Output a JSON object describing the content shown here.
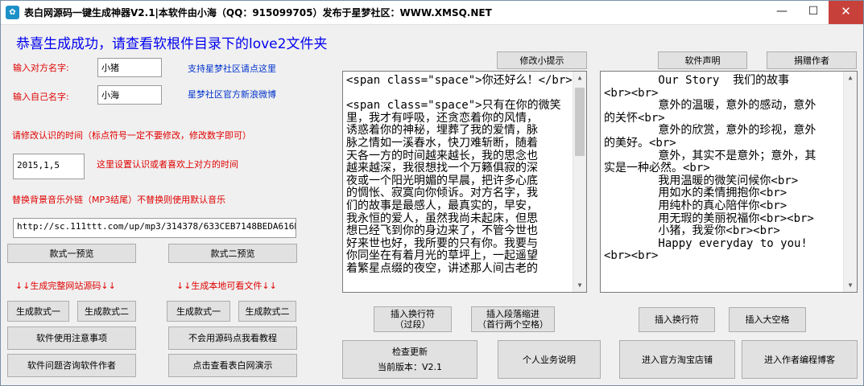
{
  "window": {
    "title": "表白网源码一键生成神器V2.1|本软件由小海（QQ：915099705）发布于星梦社区：WWW.XMSQ.NET",
    "minimize": "—",
    "maximize": "☐",
    "close": "✕"
  },
  "banner": "恭喜生成成功，请查看软根件目录下的love2文件夹",
  "form": {
    "partner_label": "输入对方名字:",
    "partner_value": "小猪",
    "self_label": "输入自己名字:",
    "self_value": "小海",
    "link_support": "支持星梦社区请点这里",
    "link_weibo": "星梦社区官方新浪微博",
    "date_instruction": "请修改认识的时间（标点符号一定不要修改，修改数字即可）",
    "date_value": "2015,1,5",
    "date_hint": "这里设置认识或者喜欢上对方的时间",
    "music_instruction": "替换背景音乐外链（MP3结尾）不替换则使用默认音乐",
    "music_value": "http://sc.111ttt.com/up/mp3/314378/633CEB7148BEDA616BFE982"
  },
  "left_buttons": {
    "preview1": "款式一预览",
    "preview2": "款式二预览",
    "header_web": "↓↓生成完整网站源码↓↓",
    "header_local": "↓↓生成本地可看文件↓↓",
    "gen_web_1": "生成款式一",
    "gen_web_2": "生成款式二",
    "gen_local_1": "生成款式一",
    "gen_local_2": "生成款式二",
    "notes": "软件使用注意事项",
    "tutorial": "不会用源码点我看教程",
    "consult": "软件问题咨询软件作者",
    "demo": "点击查看表白网演示"
  },
  "editor": {
    "modify_tip": "修改小提示",
    "text": "<span class=\"space\">你还好么！</br>\n\n<span class=\"space\">只有在你的微笑\n里，我才有呼吸，还贪恋着你的风情，\n诱惑着你的神秘，埋葬了我的爱情，脉\n脉之情如一溪春水，快刀难斩断，随着\n天各一方的时间越来越长，我的思念也\n越来越深，我很想找一个万籁俱寂的深\n夜或一个阳光明媚的早晨，把许多心底\n的惆怅、寂寞向你倾诉。对方名字，我\n们的故事是最感人，最真实的，早安，\n我永恒的爱人，虽然我尚未起床，但思\n想已经飞到你的身边来了，不管今世也\n好来世也好，我所要的只有你。我要与\n你同坐在有着月光的草坪上，一起遥望\n着繁星点缀的夜空，讲述那人间古老的",
    "insert_br": "插入换行符\n（过段）",
    "insert_indent": "插入段落缩进\n（首行两个空格）"
  },
  "right_panel": {
    "declaration": "软件声明",
    "donors": "捐赠作者",
    "text": "        Our Story  我们的故事\n<br><br>\n        意外的温暖，意外的感动，意外\n的关怀<br>\n        意外的欣赏，意外的珍视，意外\n的美好。<br>\n        意外，其实不是意外；意外，其\n实是一种必然。<br>\n        我用温暖的微笑问候你<br>\n        用如水的柔情拥抱你<br>\n        用纯朴的真心陪伴你<br>\n        用无瑕的美丽祝福你<br><br>\n        小猪，我爱你<br><br>\n        Happy everyday to you!\n<br><br>",
    "insert_br": "插入换行符",
    "insert_space": "插入大空格"
  },
  "bottom": {
    "check_update": "检查更新",
    "current_version": "当前版本：V2.1",
    "business": "个人业务说明",
    "taobao": "进入官方淘宝店铺",
    "blog": "进入作者编程博客"
  },
  "colors": {
    "banner": "#0000ee",
    "label_red": "#e00000",
    "link_blue": "#0033cc",
    "close_red": "#c7413a"
  },
  "icons": {
    "app": "app-icon",
    "scroll_up": "chevron-up-icon",
    "scroll_down": "chevron-down-icon"
  }
}
